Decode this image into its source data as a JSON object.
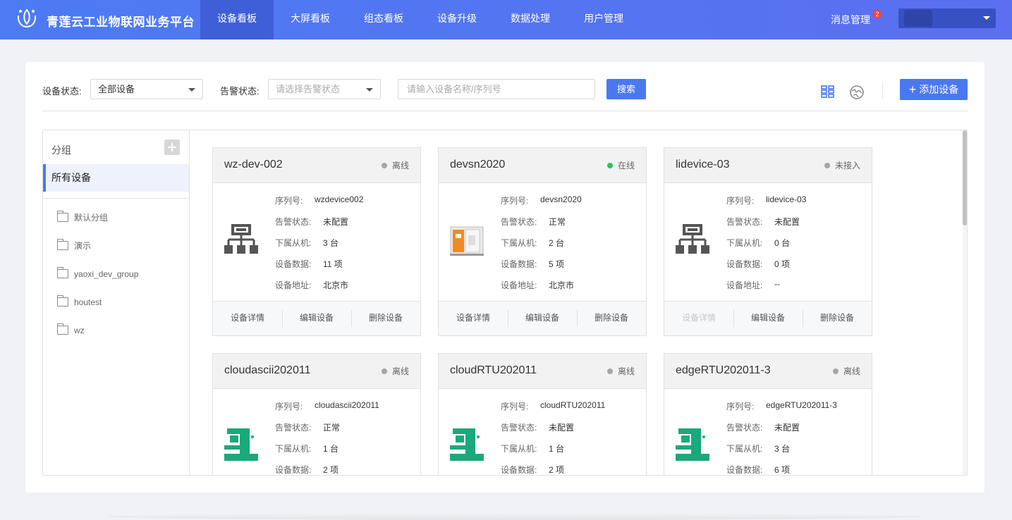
{
  "header": {
    "brand": "青莲云工业物联网业务平台",
    "nav": [
      "设备看板",
      "大屏看板",
      "组态看板",
      "设备升级",
      "数据处理",
      "用户管理"
    ],
    "active_nav": "设备看板",
    "messages_label": "消息管理",
    "messages_count": "2",
    "colors": {
      "bar_start": "#4c7bf3",
      "bar_end": "#5b6ff0",
      "active": "#3f5fd8"
    }
  },
  "filters": {
    "device_status_label": "设备状态:",
    "device_status_value": "全部设备",
    "alarm_status_label": "告警状态:",
    "alarm_status_placeholder": "请选择告警状态",
    "search_placeholder": "请输入设备名称/序列号",
    "search_button": "搜索",
    "add_button": "添加设备",
    "view_icons": [
      "grid-view-icon",
      "map-view-icon"
    ]
  },
  "sidebar": {
    "title": "分组",
    "all_devices": "所有设备",
    "groups": [
      "默认分组",
      "演示",
      "yaoxi_dev_group",
      "houtest",
      "wz"
    ]
  },
  "card_labels": {
    "serial": "序列号:",
    "alarm": "告警状态:",
    "slaves": "下属从机:",
    "data": "设备数据:",
    "address": "设备地址:",
    "detail": "设备详情",
    "edit": "编辑设备",
    "delete": "删除设备"
  },
  "status_colors": {
    "离线": "#a6a6a6",
    "在线": "#2bc45a",
    "未接入": "#a6a6a6"
  },
  "devices": [
    {
      "name": "wz-dev-002",
      "status": "离线",
      "serial": "wzdevice002",
      "alarm": "未配置",
      "slaves": "3 台",
      "data": "11 项",
      "address": "北京市",
      "icon": "network-topology-icon",
      "detail_disabled": false
    },
    {
      "name": "devsn2020",
      "status": "在线",
      "serial": "devsn2020",
      "alarm": "正常",
      "slaves": "2 台",
      "data": "5 项",
      "address": "北京市",
      "icon": "cnc-machine-icon",
      "detail_disabled": false
    },
    {
      "name": "lidevice-03",
      "status": "未接入",
      "serial": "lidevice-03",
      "alarm": "未配置",
      "slaves": "0 台",
      "data": "0 项",
      "address": "--",
      "icon": "network-topology-icon",
      "detail_disabled": true
    },
    {
      "name": "cloudascii202011",
      "status": "离线",
      "serial": "cloudascii202011",
      "alarm": "正常",
      "slaves": "1 台",
      "data": "2 项",
      "address": "",
      "icon": "press-machine-icon",
      "detail_disabled": false
    },
    {
      "name": "cloudRTU202011",
      "status": "离线",
      "serial": "cloudRTU202011",
      "alarm": "未配置",
      "slaves": "1 台",
      "data": "2 项",
      "address": "",
      "icon": "press-machine-icon",
      "detail_disabled": false
    },
    {
      "name": "edgeRTU202011-3",
      "status": "离线",
      "serial": "edgeRTU202011-3",
      "alarm": "未配置",
      "slaves": "3 台",
      "data": "6 项",
      "address": "",
      "icon": "press-machine-icon",
      "detail_disabled": false
    }
  ]
}
